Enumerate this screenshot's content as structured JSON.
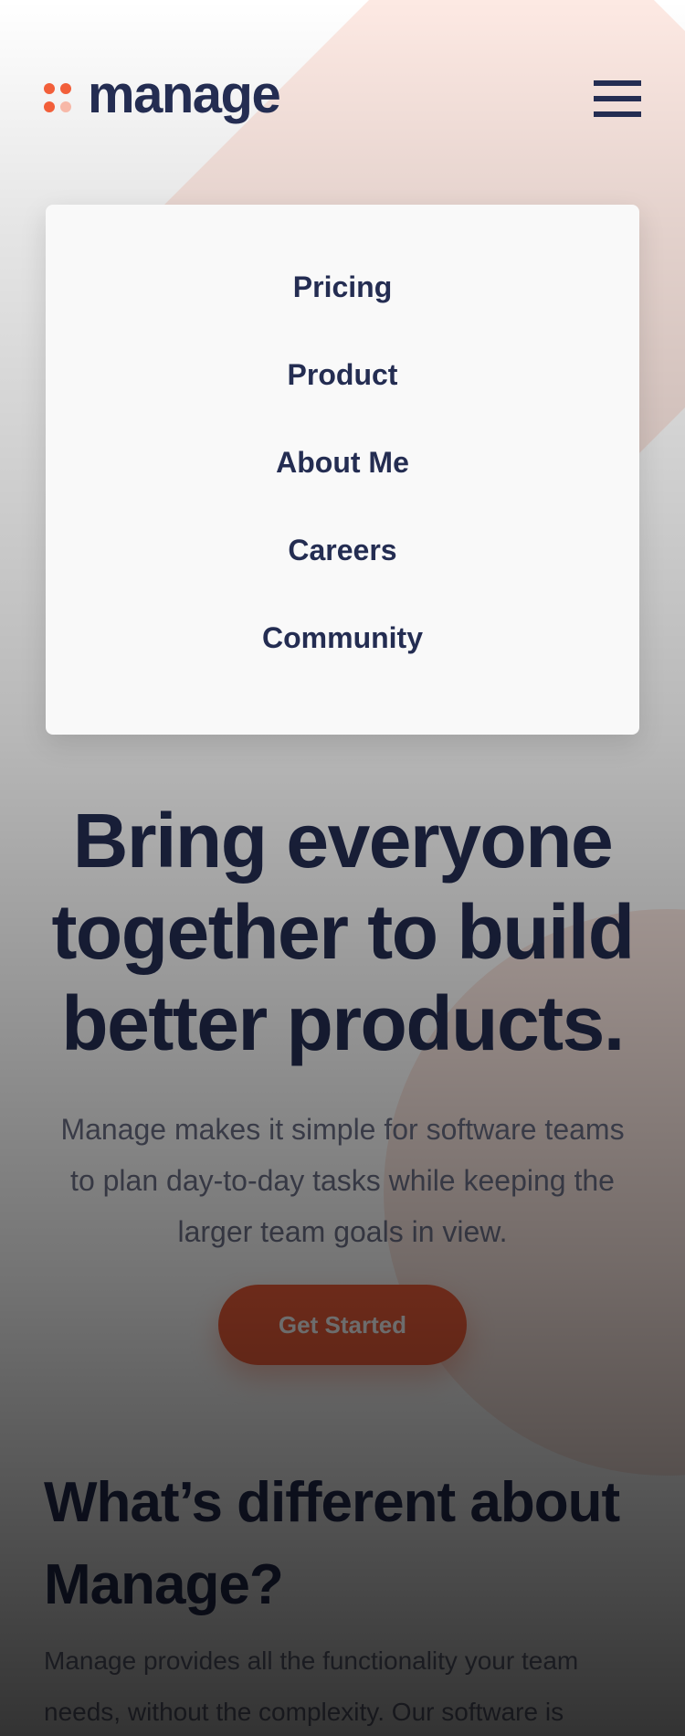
{
  "brand": {
    "name": "manage",
    "colors": {
      "primary": "#242d52",
      "accent": "#f25f3a",
      "accent_light": "#f7b8a8"
    }
  },
  "header": {
    "logo_icon": "four-dot-logo-icon",
    "menu_icon": "hamburger-menu-icon"
  },
  "menu": {
    "items": [
      {
        "label": "Pricing"
      },
      {
        "label": "Product"
      },
      {
        "label": "About Me"
      },
      {
        "label": "Careers"
      },
      {
        "label": "Community"
      }
    ]
  },
  "hero": {
    "title": "Bring everyone together to build better products.",
    "description": "Manage makes it simple for software teams to plan day-to-day tasks while keeping the larger team goals in view.",
    "cta_label": "Get Started"
  },
  "different": {
    "title": "What’s different about Manage?",
    "description": "Manage provides all the functionality your team needs, without the complexity. Our software is"
  }
}
